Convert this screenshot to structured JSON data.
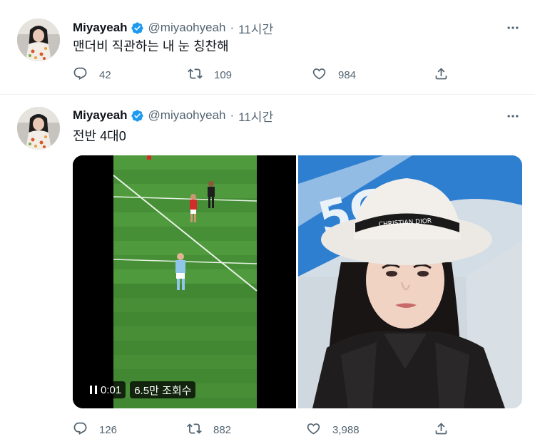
{
  "tweets": [
    {
      "name": "Miyayeah",
      "handle": "@miyaohyeah",
      "separator": "·",
      "time": "11시간",
      "text": "맨더비 직관하는 내 눈 칭찬해",
      "replies": "42",
      "retweets": "109",
      "likes": "984"
    },
    {
      "name": "Miyayeah",
      "handle": "@miyaohyeah",
      "separator": "·",
      "time": "11시간",
      "text": "전반 4대0",
      "video": {
        "elapsed": "0:01",
        "views": "6.5만 조회수"
      },
      "replies": "126",
      "retweets": "882",
      "likes": "3,988"
    }
  ],
  "colors": {
    "verified": "#1d9bf0",
    "secondary_text": "#536471",
    "divider": "#eff3f4"
  },
  "icons": [
    "verified-badge-icon",
    "more-icon",
    "reply-icon",
    "retweet-icon",
    "like-icon",
    "share-icon",
    "pause-icon"
  ]
}
